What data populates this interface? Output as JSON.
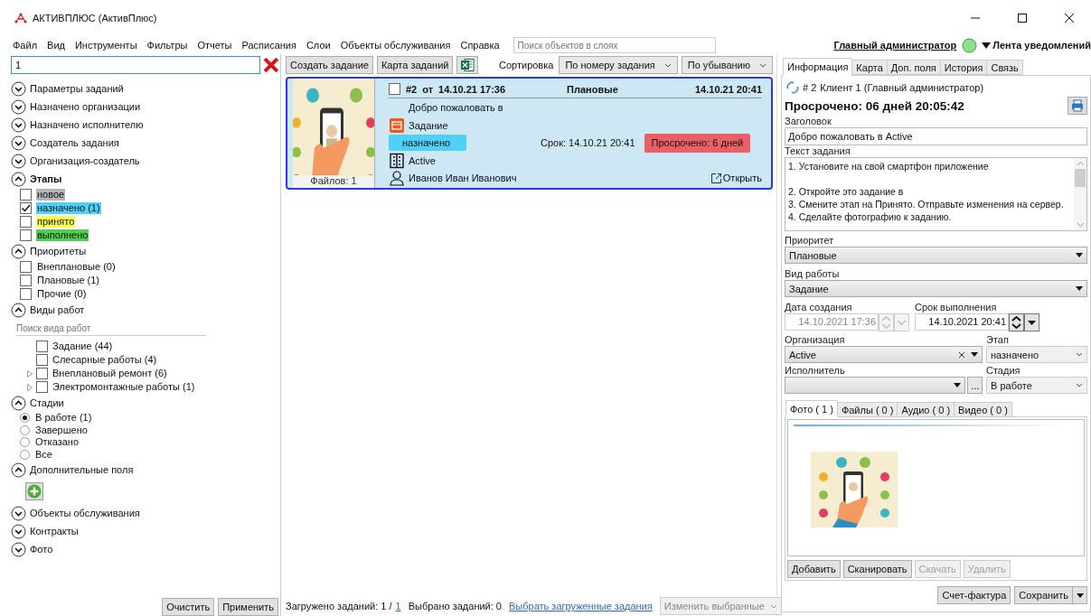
{
  "window": {
    "title": "АКТИВПЛЮС (АктивПлюс)"
  },
  "menu": [
    "Файл",
    "Вид",
    "Инструменты",
    "Фильтры",
    "Отчеты",
    "Расписания",
    "Слои",
    "Объекты обслуживания",
    "Справка"
  ],
  "layer_search": {
    "placeholder": "Поиск объектов в слоях"
  },
  "user": {
    "name": "Главный администратор",
    "notifications": "Лента уведомлений"
  },
  "filter": {
    "search_value": "1",
    "sections": [
      {
        "title": "Параметры заданий",
        "expanded": false,
        "active": false
      },
      {
        "title": "Назначено организации",
        "expanded": false,
        "active": false
      },
      {
        "title": "Назначено исполнителю",
        "expanded": false,
        "active": false
      },
      {
        "title": "Создатель задания",
        "expanded": false,
        "active": false
      },
      {
        "title": "Организация-создатель",
        "expanded": false,
        "active": false
      },
      {
        "title": "Этапы",
        "expanded": true,
        "active": true,
        "kind": "checks",
        "items": [
          {
            "label": "новое",
            "checked": false,
            "color": "#b4b4b4"
          },
          {
            "label": "назначено (1)",
            "checked": true,
            "color": "#50d0f8"
          },
          {
            "label": "принято",
            "checked": false,
            "color": "#ffff50"
          },
          {
            "label": "выполнено",
            "checked": false,
            "color": "#50d050"
          }
        ]
      },
      {
        "title": "Приоритеты",
        "expanded": true,
        "active": false,
        "kind": "checks",
        "items": [
          {
            "label": "Внеплановые (0)",
            "checked": false
          },
          {
            "label": "Плановые (1)",
            "checked": false
          },
          {
            "label": "Прочие (0)",
            "checked": false
          }
        ]
      },
      {
        "title": "Виды работ",
        "expanded": true,
        "active": false,
        "kind": "tree",
        "placeholder": "Поиск вида работ",
        "items": [
          {
            "label": "Задание (44)",
            "checked": false,
            "expandable": false
          },
          {
            "label": "Слесарные работы (4)",
            "checked": false,
            "expandable": false
          },
          {
            "label": "Внеплановый ремонт (6)",
            "checked": false,
            "expandable": true
          },
          {
            "label": "Электромонтажные работы (1)",
            "checked": false,
            "expandable": true
          }
        ]
      },
      {
        "title": "Стадии",
        "expanded": true,
        "active": false,
        "kind": "radios",
        "items": [
          {
            "label": "В работе (1)",
            "selected": true
          },
          {
            "label": "Завершено",
            "selected": false
          },
          {
            "label": "Отказано",
            "selected": false
          },
          {
            "label": "Все",
            "selected": false
          }
        ]
      },
      {
        "title": "Дополнительные поля",
        "expanded": true,
        "active": false,
        "kind": "add"
      },
      {
        "title": "Объекты обслуживания",
        "expanded": false,
        "active": false
      },
      {
        "title": "Контракты",
        "expanded": false,
        "active": false
      },
      {
        "title": "Фото",
        "expanded": false,
        "active": false
      }
    ],
    "buttons": [
      "Очистить",
      "Применить"
    ]
  },
  "toolbar": {
    "buttons": [
      "Создать задание",
      "Карта заданий"
    ],
    "sort_label": "Сортировка",
    "sort_by": "По номеру задания",
    "sort_order": "По убыванию"
  },
  "task": {
    "selected": true,
    "checked": false,
    "number": "#2",
    "from": "от",
    "created": "14.10.21 17:36",
    "priority": "Плановые",
    "due_header": "14.10.21 20:41",
    "title": "Добро пожаловать в",
    "type": "Задание",
    "stage": "назначено",
    "deadline": "Срок: 14.10.21 20:41",
    "overdue": "Просрочено: 6 дней",
    "organization": "Active",
    "executor": "Иванов Иван Иванович",
    "open": "Открыть",
    "files": "Файлов: 1"
  },
  "status_bar": {
    "loaded": "Загружено заданий: 1 /",
    "loaded_link": "1",
    "selected": "Выбрано заданий: 0",
    "select_link": "Выбрать загруженные задания",
    "change_button": {
      "label": "Изменить выбранные",
      "disabled": true
    }
  },
  "details": {
    "tabs": [
      {
        "label": "Информация",
        "selected": true
      },
      {
        "label": "Карта",
        "selected": false
      },
      {
        "label": "Доп. поля",
        "selected": false
      },
      {
        "label": "История",
        "selected": false
      },
      {
        "label": "Связь",
        "selected": false
      }
    ],
    "number": "# 2",
    "client": "Клиент 1 (Главный администратор)",
    "overdue": "Просрочено: 06 дней 20:05:42",
    "title_label": "Заголовок",
    "title_value": "Добро пожаловать в Active",
    "text_label": "Текст задания",
    "text_lines": [
      "1. Установите на свой смартфон приложение",
      "2. Откройте это задание в",
      "3. Смените этап на Принято. Отправьте изменения на сервер.",
      "4. Сделайте фотографию к заданию."
    ],
    "priority_label": "Приоритет",
    "priority": "Плановые",
    "work_label": "Вид работы",
    "work": "Задание",
    "created_label": "Дата создания",
    "created": "14.10.2021 17:36",
    "due_label": "Срок выполнения",
    "due": "14.10.2021 20:41",
    "org_label": "Организация",
    "org": "Active",
    "stage_label": "Этап",
    "stage": "назначено",
    "executor_label": "Исполнитель",
    "more": "...",
    "phase_label": "Стадия",
    "phase": "В работе",
    "media_tabs": [
      {
        "label": "Фото ( 1 )",
        "selected": true
      },
      {
        "label": "Файлы ( 0 )",
        "selected": false
      },
      {
        "label": "Аудио ( 0 )",
        "selected": false
      },
      {
        "label": "Видео ( 0 )",
        "selected": false
      }
    ],
    "media_buttons": [
      {
        "label": "Добавить",
        "disabled": false
      },
      {
        "label": "Сканировать",
        "disabled": false
      },
      {
        "label": "Скачать",
        "disabled": true
      },
      {
        "label": "Удалить",
        "disabled": true
      }
    ],
    "invoice": "Счет-фактура",
    "save": "Сохранить"
  }
}
